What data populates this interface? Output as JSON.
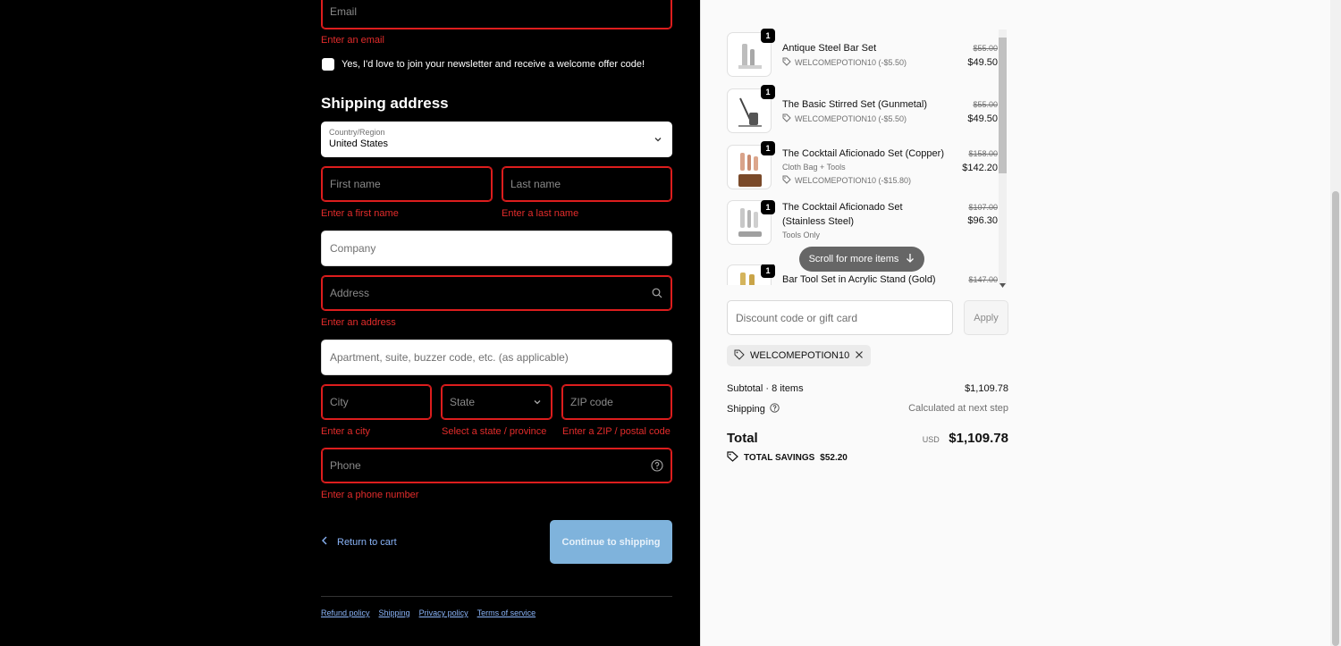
{
  "contact": {
    "email_placeholder": "Email",
    "email_error": "Enter an email",
    "newsletter_label": "Yes, I'd love to join your newsletter and receive a welcome offer code!"
  },
  "shipping": {
    "heading": "Shipping address",
    "country_label": "Country/Region",
    "country_value": "United States",
    "first_name_placeholder": "First name",
    "first_name_error": "Enter a first name",
    "last_name_placeholder": "Last name",
    "last_name_error": "Enter a last name",
    "company_placeholder": "Company",
    "address_placeholder": "Address",
    "address_error": "Enter an address",
    "apartment_placeholder": "Apartment, suite, buzzer code, etc. (as applicable)",
    "city_placeholder": "City",
    "city_error": "Enter a city",
    "state_placeholder": "State",
    "state_error": "Select a state / province",
    "zip_placeholder": "ZIP code",
    "zip_error": "Enter a ZIP / postal code",
    "phone_placeholder": "Phone",
    "phone_error": "Enter a phone number"
  },
  "actions": {
    "return_label": "Return to cart",
    "continue_label": "Continue to shipping"
  },
  "footer": {
    "links": [
      "Refund policy",
      "Shipping",
      "Privacy policy",
      "Terms of service"
    ]
  },
  "cart": {
    "items": [
      {
        "name": "Antique Steel Bar Set",
        "variant": "",
        "discount": "WELCOMEPOTION10 (-$5.50)",
        "old_price": "$55.00",
        "price": "$49.50",
        "qty": "1"
      },
      {
        "name": "The Basic Stirred Set (Gunmetal)",
        "variant": "",
        "discount": "WELCOMEPOTION10 (-$5.50)",
        "old_price": "$55.00",
        "price": "$49.50",
        "qty": "1"
      },
      {
        "name": "The Cocktail Aficionado Set (Copper)",
        "variant": "Cloth Bag + Tools",
        "discount": "WELCOMEPOTION10 (-$15.80)",
        "old_price": "$158.00",
        "price": "$142.20",
        "qty": "1"
      },
      {
        "name": "The Cocktail Aficionado Set (Stainless Steel)",
        "variant": "Tools Only",
        "discount": "",
        "old_price": "$107.00",
        "price": "$96.30",
        "qty": "1"
      },
      {
        "name": "Bar Tool Set in Acrylic Stand (Gold)",
        "variant": "",
        "discount": "",
        "old_price": "$147.00",
        "price": "",
        "qty": "1"
      }
    ],
    "scroll_hint": "Scroll for more items",
    "discount_placeholder": "Discount code or gift card",
    "apply_label": "Apply",
    "applied_code": "WELCOMEPOTION10",
    "subtotal_label": "Subtotal · 8 items",
    "subtotal_value": "$1,109.78",
    "shipping_label": "Shipping",
    "shipping_value": "Calculated at next step",
    "total_label": "Total",
    "currency": "USD",
    "total_value": "$1,109.78",
    "savings_label": "TOTAL SAVINGS",
    "savings_value": "$52.20"
  }
}
